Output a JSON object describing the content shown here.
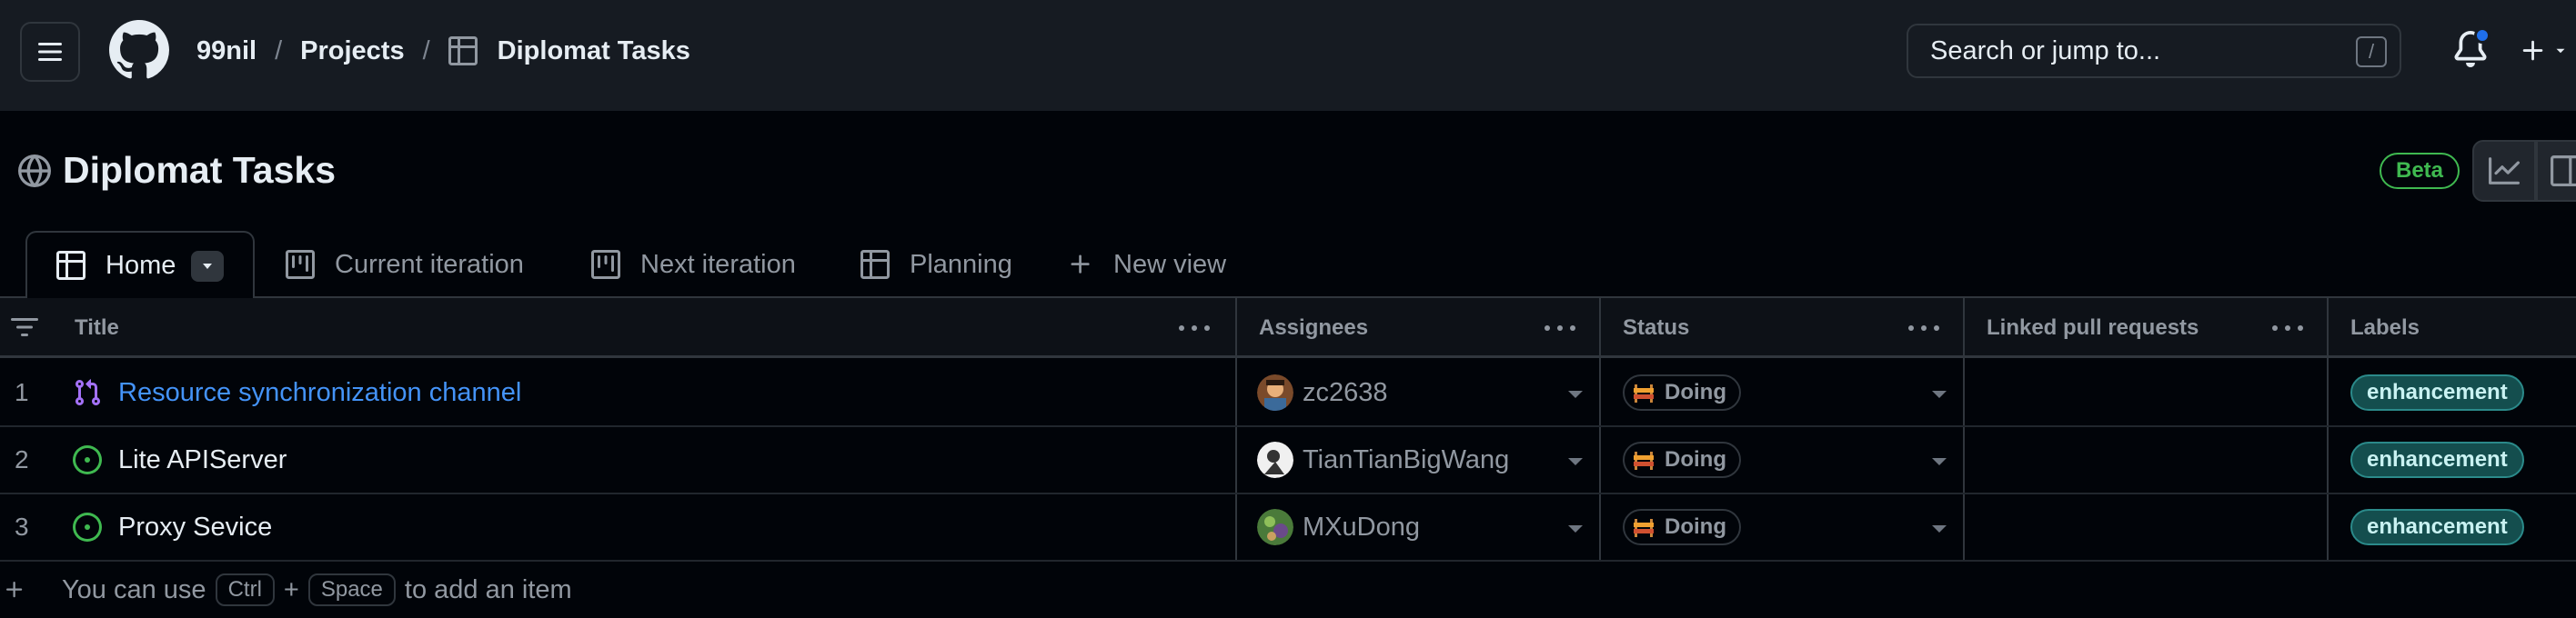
{
  "header": {
    "owner": "99nil",
    "section": "Projects",
    "project": "Diplomat Tasks",
    "search_placeholder": "Search or jump to...",
    "search_shortcut": "/"
  },
  "project": {
    "title": "Diplomat Tasks",
    "badge": "Beta"
  },
  "tabs": [
    {
      "label": "Home"
    },
    {
      "label": "Current iteration"
    },
    {
      "label": "Next iteration"
    },
    {
      "label": "Planning"
    },
    {
      "label": "New view"
    }
  ],
  "columns": [
    "Title",
    "Assignees",
    "Status",
    "Linked pull requests",
    "Labels"
  ],
  "rows": [
    {
      "num": "1",
      "title": "Resource synchronization channel",
      "type": "pull-request",
      "assignee": "zc2638",
      "status": "Doing",
      "label": "enhancement"
    },
    {
      "num": "2",
      "title": "Lite APIServer",
      "type": "open-issue",
      "assignee": "TianTianBigWang",
      "status": "Doing",
      "label": "enhancement"
    },
    {
      "num": "3",
      "title": "Proxy Sevice",
      "type": "open-issue",
      "assignee": "MXuDong",
      "status": "Doing",
      "label": "enhancement"
    }
  ],
  "add_item": {
    "prefix": "You can use",
    "key1": "Ctrl",
    "plus": "+",
    "key2": "Space",
    "suffix": "to add an item"
  },
  "colors": {
    "accent_blue": "#4493f8",
    "open_green": "#3fb950",
    "pr_purple": "#a371f7",
    "label_teal": "#144e4e"
  }
}
